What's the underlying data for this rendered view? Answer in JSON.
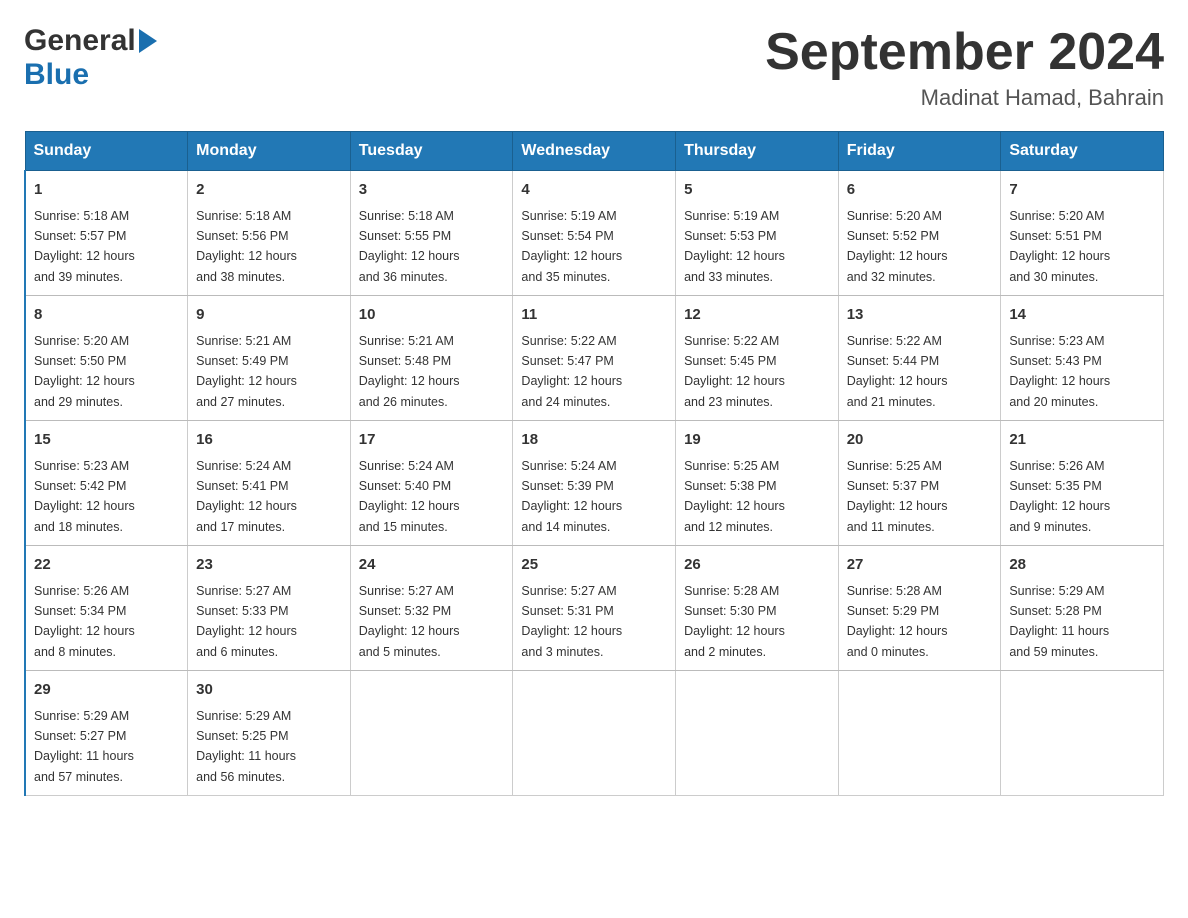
{
  "header": {
    "logo_general": "General",
    "logo_blue": "Blue",
    "month_title": "September 2024",
    "location": "Madinat Hamad, Bahrain"
  },
  "columns": [
    "Sunday",
    "Monday",
    "Tuesday",
    "Wednesday",
    "Thursday",
    "Friday",
    "Saturday"
  ],
  "weeks": [
    [
      {
        "day": "1",
        "sunrise": "5:18 AM",
        "sunset": "5:57 PM",
        "daylight": "12 hours and 39 minutes."
      },
      {
        "day": "2",
        "sunrise": "5:18 AM",
        "sunset": "5:56 PM",
        "daylight": "12 hours and 38 minutes."
      },
      {
        "day": "3",
        "sunrise": "5:18 AM",
        "sunset": "5:55 PM",
        "daylight": "12 hours and 36 minutes."
      },
      {
        "day": "4",
        "sunrise": "5:19 AM",
        "sunset": "5:54 PM",
        "daylight": "12 hours and 35 minutes."
      },
      {
        "day": "5",
        "sunrise": "5:19 AM",
        "sunset": "5:53 PM",
        "daylight": "12 hours and 33 minutes."
      },
      {
        "day": "6",
        "sunrise": "5:20 AM",
        "sunset": "5:52 PM",
        "daylight": "12 hours and 32 minutes."
      },
      {
        "day": "7",
        "sunrise": "5:20 AM",
        "sunset": "5:51 PM",
        "daylight": "12 hours and 30 minutes."
      }
    ],
    [
      {
        "day": "8",
        "sunrise": "5:20 AM",
        "sunset": "5:50 PM",
        "daylight": "12 hours and 29 minutes."
      },
      {
        "day": "9",
        "sunrise": "5:21 AM",
        "sunset": "5:49 PM",
        "daylight": "12 hours and 27 minutes."
      },
      {
        "day": "10",
        "sunrise": "5:21 AM",
        "sunset": "5:48 PM",
        "daylight": "12 hours and 26 minutes."
      },
      {
        "day": "11",
        "sunrise": "5:22 AM",
        "sunset": "5:47 PM",
        "daylight": "12 hours and 24 minutes."
      },
      {
        "day": "12",
        "sunrise": "5:22 AM",
        "sunset": "5:45 PM",
        "daylight": "12 hours and 23 minutes."
      },
      {
        "day": "13",
        "sunrise": "5:22 AM",
        "sunset": "5:44 PM",
        "daylight": "12 hours and 21 minutes."
      },
      {
        "day": "14",
        "sunrise": "5:23 AM",
        "sunset": "5:43 PM",
        "daylight": "12 hours and 20 minutes."
      }
    ],
    [
      {
        "day": "15",
        "sunrise": "5:23 AM",
        "sunset": "5:42 PM",
        "daylight": "12 hours and 18 minutes."
      },
      {
        "day": "16",
        "sunrise": "5:24 AM",
        "sunset": "5:41 PM",
        "daylight": "12 hours and 17 minutes."
      },
      {
        "day": "17",
        "sunrise": "5:24 AM",
        "sunset": "5:40 PM",
        "daylight": "12 hours and 15 minutes."
      },
      {
        "day": "18",
        "sunrise": "5:24 AM",
        "sunset": "5:39 PM",
        "daylight": "12 hours and 14 minutes."
      },
      {
        "day": "19",
        "sunrise": "5:25 AM",
        "sunset": "5:38 PM",
        "daylight": "12 hours and 12 minutes."
      },
      {
        "day": "20",
        "sunrise": "5:25 AM",
        "sunset": "5:37 PM",
        "daylight": "12 hours and 11 minutes."
      },
      {
        "day": "21",
        "sunrise": "5:26 AM",
        "sunset": "5:35 PM",
        "daylight": "12 hours and 9 minutes."
      }
    ],
    [
      {
        "day": "22",
        "sunrise": "5:26 AM",
        "sunset": "5:34 PM",
        "daylight": "12 hours and 8 minutes."
      },
      {
        "day": "23",
        "sunrise": "5:27 AM",
        "sunset": "5:33 PM",
        "daylight": "12 hours and 6 minutes."
      },
      {
        "day": "24",
        "sunrise": "5:27 AM",
        "sunset": "5:32 PM",
        "daylight": "12 hours and 5 minutes."
      },
      {
        "day": "25",
        "sunrise": "5:27 AM",
        "sunset": "5:31 PM",
        "daylight": "12 hours and 3 minutes."
      },
      {
        "day": "26",
        "sunrise": "5:28 AM",
        "sunset": "5:30 PM",
        "daylight": "12 hours and 2 minutes."
      },
      {
        "day": "27",
        "sunrise": "5:28 AM",
        "sunset": "5:29 PM",
        "daylight": "12 hours and 0 minutes."
      },
      {
        "day": "28",
        "sunrise": "5:29 AM",
        "sunset": "5:28 PM",
        "daylight": "11 hours and 59 minutes."
      }
    ],
    [
      {
        "day": "29",
        "sunrise": "5:29 AM",
        "sunset": "5:27 PM",
        "daylight": "11 hours and 57 minutes."
      },
      {
        "day": "30",
        "sunrise": "5:29 AM",
        "sunset": "5:25 PM",
        "daylight": "11 hours and 56 minutes."
      },
      null,
      null,
      null,
      null,
      null
    ]
  ],
  "labels": {
    "sunrise": "Sunrise:",
    "sunset": "Sunset:",
    "daylight": "Daylight:"
  }
}
